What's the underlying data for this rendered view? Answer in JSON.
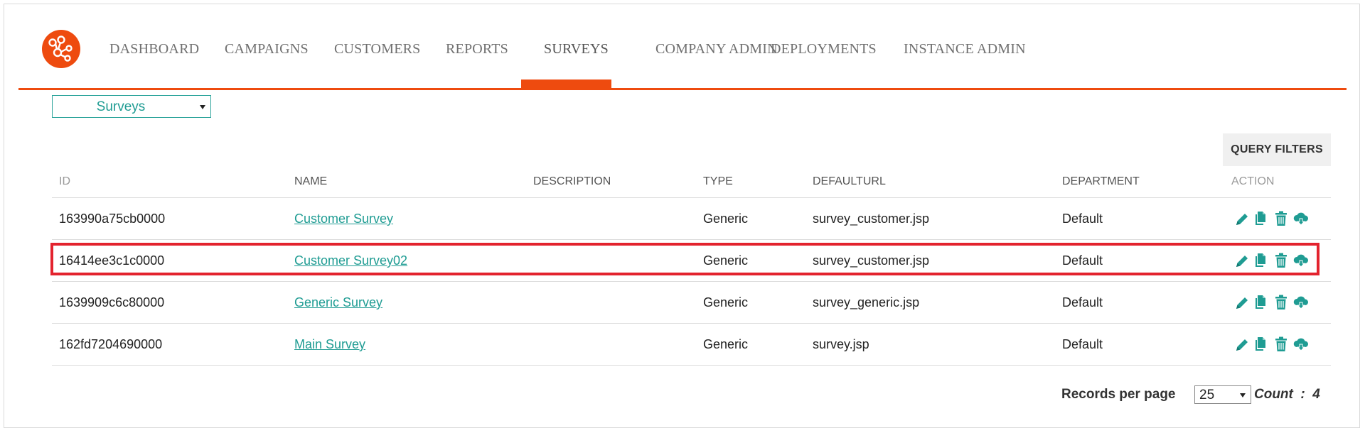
{
  "nav": {
    "items": [
      {
        "label": "DASHBOARD",
        "id": "dashboard"
      },
      {
        "label": "CAMPAIGNS",
        "id": "campaigns"
      },
      {
        "label": "CUSTOMERS",
        "id": "customers"
      },
      {
        "label": "REPORTS",
        "id": "reports"
      },
      {
        "label": "SURVEYS",
        "id": "surveys",
        "active": true
      },
      {
        "label": "COMPANY ADMIN",
        "id": "company-admin"
      },
      {
        "label": "DEPLOYMENTS",
        "id": "deployments"
      },
      {
        "label": "INSTANCE ADMIN",
        "id": "instance-admin"
      }
    ],
    "accent_color": "#ee4b0f"
  },
  "module_select": {
    "value": "Surveys"
  },
  "query_filters": {
    "label": "QUERY FILTERS"
  },
  "table": {
    "headers": {
      "id": "ID",
      "name": "NAME",
      "description": "DESCRIPTION",
      "type": "TYPE",
      "defaulturl": "DEFAULTURL",
      "department": "DEPARTMENT",
      "action": "ACTION"
    },
    "rows": [
      {
        "id": "163990a75cb0000",
        "name": "Customer Survey",
        "description": "",
        "type": "Generic",
        "defaulturl": "survey_customer.jsp",
        "department": "Default"
      },
      {
        "id": "16414ee3c1c0000",
        "name": "Customer Survey02",
        "description": "",
        "type": "Generic",
        "defaulturl": "survey_customer.jsp",
        "department": "Default",
        "highlighted": true
      },
      {
        "id": "1639909c6c80000",
        "name": "Generic Survey",
        "description": "",
        "type": "Generic",
        "defaulturl": "survey_generic.jsp",
        "department": "Default"
      },
      {
        "id": "162fd7204690000",
        "name": "Main Survey",
        "description": "",
        "type": "Generic",
        "defaulturl": "survey.jsp",
        "department": "Default"
      }
    ],
    "action_icons": [
      "edit-icon",
      "copy-icon",
      "trash-icon",
      "cloud-download-icon"
    ],
    "link_color": "#1f9c93",
    "highlight_color": "#e3232e"
  },
  "footer": {
    "records_per_page_label": "Records per page",
    "records_per_page_value": "25",
    "count_text": "Count  :  4"
  }
}
